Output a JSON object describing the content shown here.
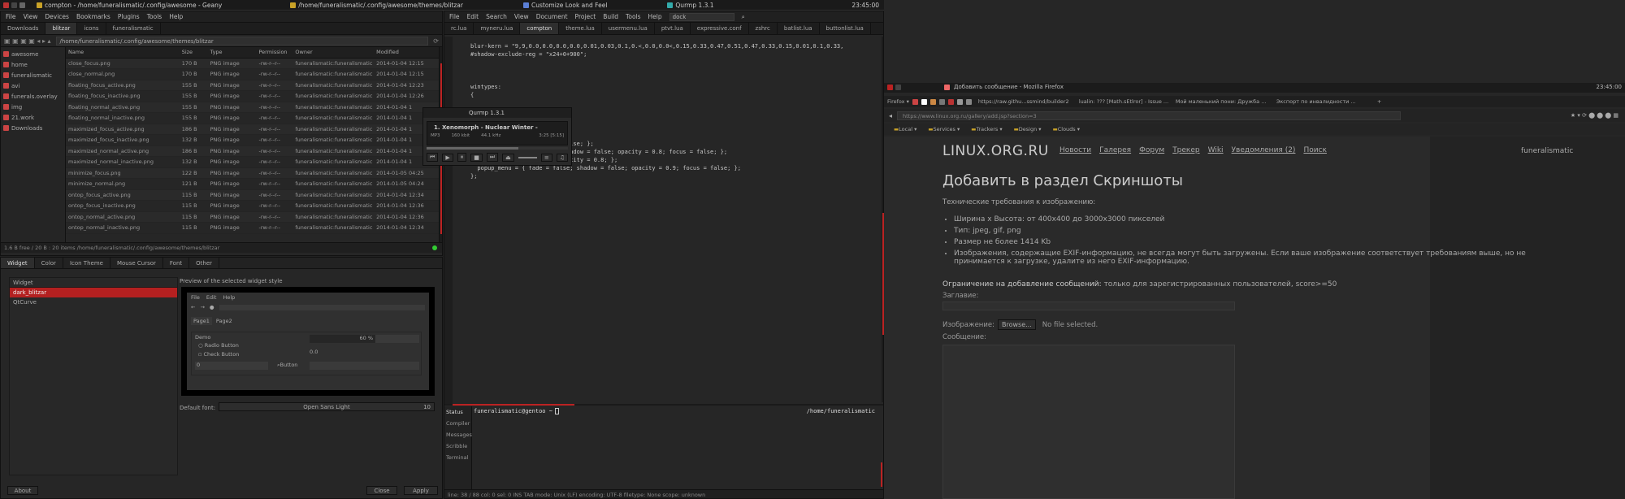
{
  "topbar": {
    "items": [
      {
        "label": "compton - /home/funeralismatic/.config/awesome - Geany",
        "color": "#c9a227"
      },
      {
        "label": "/home/funeralismatic/.config/awesome/themes/blitzar",
        "color": "#c9a227"
      },
      {
        "label": "Customize Look and Feel",
        "color": "#5b7fd6"
      },
      {
        "label": "Qurmp 1.3.1",
        "color": "#3aa"
      }
    ],
    "clock": "23:45:00"
  },
  "filemanager": {
    "menu": [
      "File",
      "View",
      "Devices",
      "Bookmarks",
      "Plugins",
      "Tools",
      "Help"
    ],
    "tabs": [
      "Downloads",
      "blitzar",
      "icons",
      "funeralismatic"
    ],
    "path": "/home/funeralismatic/.config/awesome/themes/blitzar",
    "places": [
      "awesome",
      "home",
      "funeralismatic",
      "avi",
      "funerals.overlay",
      "img",
      "21.work",
      "Downloads"
    ],
    "columns": [
      "Name",
      "Size",
      "Type",
      "Permission",
      "Owner",
      "Modified"
    ],
    "files": [
      {
        "name": "close_focus.png",
        "size": "170 B",
        "type": "PNG image",
        "perm": "-rw-r--r--",
        "owner": "funeralismatic:funeralismatic",
        "modified": "2014-01-04 12:15"
      },
      {
        "name": "close_normal.png",
        "size": "170 B",
        "type": "PNG image",
        "perm": "-rw-r--r--",
        "owner": "funeralismatic:funeralismatic",
        "modified": "2014-01-04 12:15"
      },
      {
        "name": "floating_focus_active.png",
        "size": "155 B",
        "type": "PNG image",
        "perm": "-rw-r--r--",
        "owner": "funeralismatic:funeralismatic",
        "modified": "2014-01-04 12:23"
      },
      {
        "name": "floating_focus_inactive.png",
        "size": "155 B",
        "type": "PNG image",
        "perm": "-rw-r--r--",
        "owner": "funeralismatic:funeralismatic",
        "modified": "2014-01-04 12:26"
      },
      {
        "name": "floating_normal_active.png",
        "size": "155 B",
        "type": "PNG image",
        "perm": "-rw-r--r--",
        "owner": "funeralismatic:funeralismatic",
        "modified": "2014-01-04 1"
      },
      {
        "name": "floating_normal_inactive.png",
        "size": "155 B",
        "type": "PNG image",
        "perm": "-rw-r--r--",
        "owner": "funeralismatic:funeralismatic",
        "modified": "2014-01-04 1"
      },
      {
        "name": "maximized_focus_active.png",
        "size": "186 B",
        "type": "PNG image",
        "perm": "-rw-r--r--",
        "owner": "funeralismatic:funeralismatic",
        "modified": "2014-01-04 1"
      },
      {
        "name": "maximized_focus_inactive.png",
        "size": "132 B",
        "type": "PNG image",
        "perm": "-rw-r--r--",
        "owner": "funeralismatic:funeralismatic",
        "modified": "2014-01-04 1"
      },
      {
        "name": "maximized_normal_active.png",
        "size": "186 B",
        "type": "PNG image",
        "perm": "-rw-r--r--",
        "owner": "funeralismatic:funeralismatic",
        "modified": "2014-01-04 1"
      },
      {
        "name": "maximized_normal_inactive.png",
        "size": "132 B",
        "type": "PNG image",
        "perm": "-rw-r--r--",
        "owner": "funeralismatic:funeralismatic",
        "modified": "2014-01-04 1"
      },
      {
        "name": "minimize_focus.png",
        "size": "122 B",
        "type": "PNG image",
        "perm": "-rw-r--r--",
        "owner": "funeralismatic:funeralismatic",
        "modified": "2014-01-05 04:25"
      },
      {
        "name": "minimize_normal.png",
        "size": "121 B",
        "type": "PNG image",
        "perm": "-rw-r--r--",
        "owner": "funeralismatic:funeralismatic",
        "modified": "2014-01-05 04:24"
      },
      {
        "name": "ontop_focus_active.png",
        "size": "115 B",
        "type": "PNG image",
        "perm": "-rw-r--r--",
        "owner": "funeralismatic:funeralismatic",
        "modified": "2014-01-04 12:34"
      },
      {
        "name": "ontop_focus_inactive.png",
        "size": "115 B",
        "type": "PNG image",
        "perm": "-rw-r--r--",
        "owner": "funeralismatic:funeralismatic",
        "modified": "2014-01-04 12:36"
      },
      {
        "name": "ontop_normal_active.png",
        "size": "115 B",
        "type": "PNG image",
        "perm": "-rw-r--r--",
        "owner": "funeralismatic:funeralismatic",
        "modified": "2014-01-04 12:36"
      },
      {
        "name": "ontop_normal_inactive.png",
        "size": "115 B",
        "type": "PNG image",
        "perm": "-rw-r--r--",
        "owner": "funeralismatic:funeralismatic",
        "modified": "2014-01-04 12:34"
      }
    ],
    "status": "1.6 B free / 20 B : 20 items   /home/funeralismatic/.config/awesome/themes/blitzar"
  },
  "lxappearance": {
    "tabs": [
      "Widget",
      "Color",
      "Icon Theme",
      "Mouse Cursor",
      "Font",
      "Other"
    ],
    "list_header": "Widget",
    "themes": [
      "dark_blitzar",
      "QtCurve"
    ],
    "preview_label": "Preview of the selected widget style",
    "preview": {
      "menu": [
        "File",
        "Edit",
        "Help"
      ],
      "tabs": [
        "Page1",
        "Page2"
      ],
      "demo": "Demo",
      "radio": "Radio Button",
      "check": "Check Button",
      "spin": "0",
      "button": "Button",
      "progress": "60 %",
      "scale": "0.0"
    },
    "default_font_label": "Default font:",
    "default_font": "Open Sans Light",
    "font_size": "10",
    "about": "About",
    "close": "Close",
    "apply": "Apply"
  },
  "geany": {
    "menu": [
      "File",
      "Edit",
      "Search",
      "View",
      "Document",
      "Project",
      "Build",
      "Tools",
      "Help"
    ],
    "search": "dock",
    "tabs": [
      "rc.lua",
      "myneru.lua",
      "compton",
      "theme.lua",
      "usermenu.lua",
      "ptvt.lua",
      "expressive.conf",
      "zshrc",
      "batlist.lua",
      "buttonlist.lua"
    ],
    "code": [
      "blur-kern = \"9,9,0.0,0.0,0.0,0.0,0.01,0.03,0.1,0.<,0.0,0.0<,0.15,0.33,0.47,0.51,0.47,0.33,0.15,0.01,0.1,0.33,",
      "#shadow-exclude-reg = \"x24+0+900\";",
      "",
      "",
      "",
      "wintypes:",
      "{",
      "",
      "",
      "",
      "",
      "",
      "              ale; focus = false; };",
      "  tooltip = { fade = true; shadow = false; opacity = 0.8; focus = false; };",
      "  notify = { fade = true; opacity = 0.8; };",
      "  popup_menu = { fade = false; shadow = false; opacity = 0.9; focus = false; };",
      "};"
    ],
    "side_tabs": [
      "Status",
      "Compiler",
      "Messages",
      "Scribble",
      "Terminal"
    ],
    "terminal_prompt": "funeralismatic@gentoo ~",
    "terminal_path": "/home/funeralismatic",
    "statusbar": "line: 38 / 88    col: 0    sel: 0    INS    TAB    mode: Unix (LF)    encoding: UTF-8    filetype: None    scope: unknown"
  },
  "qmmp": {
    "title": "Qurmp 1.3.1",
    "track": "1. Xenomorph - Nuclear Winter -",
    "format": "MP3",
    "bitrate": "160 kbit",
    "samplerate": "44.1 kHz",
    "time": "3:25 [5:15]"
  },
  "firefox": {
    "window_title": "Добавить сообщение - Mozilla Firefox",
    "clock": "23:45:00",
    "tabs": [
      "https://raw.githu...ssmind/builder2",
      "lualin: ??? [Math.sEtlror] - Issue ...",
      "Мой маленький пони: Дружба ...",
      "Экспорт по инвалидности ..."
    ],
    "url": "https://www.linux.org.ru/gallery/add.jsp?section=3",
    "bookmarks": [
      "Local",
      "Services",
      "Trackers",
      "Design",
      "Clouds"
    ],
    "site_logo": "LINUX.ORG.RU",
    "nav": [
      "Новости",
      "Галерея",
      "Форум",
      "Трекер",
      "Wiki",
      "Уведомления (2)",
      "Поиск"
    ],
    "user": "funeralismatic",
    "heading": "Добавить в раздел Скриншоты",
    "requirements_title": "Технические требования к изображению:",
    "requirements": [
      "Ширина x Высота: от 400x400 до 3000x3000 пикселей",
      "Тип: jpeg, gif, png",
      "Размер не более 1414 Kb",
      "Изображения, содержащие EXIF-информацию, не всегда могут быть загружены. Если ваше изображение соответствует требованиям выше, но не принимается к загрузке, удалите из него EXIF-информацию."
    ],
    "limit_label": "Ограничение на добавление сообщений:",
    "limit_text": "только для зарегистрированных пользователей, score>=50",
    "title_label": "Заглавие:",
    "image_label": "Изображение:",
    "browse": "Browse...",
    "no_file": "No file selected.",
    "message_label": "Сообщение:"
  }
}
